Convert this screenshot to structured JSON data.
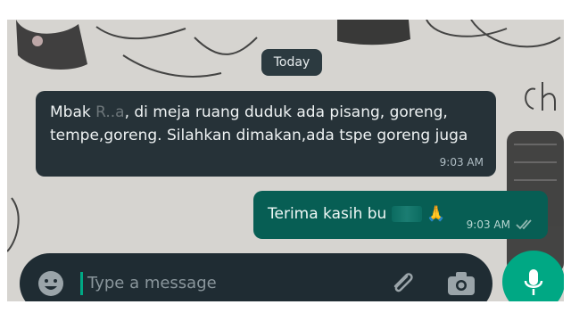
{
  "date_chip": "Today",
  "messages": {
    "incoming": {
      "text_prefix": "Mbak ",
      "text_redacted": "R..a",
      "text_rest": ", di meja ruang duduk ada pisang, goreng, tempe,goreng. Silahkan dimakan,ada tspe goreng juga",
      "time": "9:03 AM"
    },
    "outgoing": {
      "text": "Terima kasih bu",
      "emoji": "🙏",
      "time": "9:03 AM",
      "status": "read"
    }
  },
  "composer": {
    "placeholder": "Type a message",
    "emoji_icon": "emoji-icon",
    "attach_icon": "paperclip-icon",
    "camera_icon": "camera-icon"
  },
  "mic": {
    "icon": "microphone-icon"
  },
  "colors": {
    "incoming_bubble": "#263238",
    "outgoing_bubble": "#075e54",
    "accent": "#00a884",
    "composer_bg": "#1f2c33"
  }
}
